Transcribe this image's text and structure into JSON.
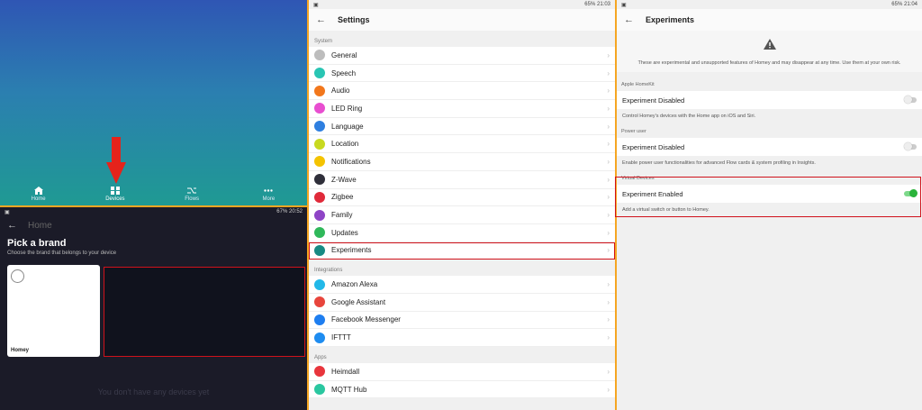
{
  "home": {
    "tabs": [
      {
        "label": "Home",
        "icon": "home-icon"
      },
      {
        "label": "Devices",
        "icon": "devices-grid-icon"
      },
      {
        "label": "Flows",
        "icon": "flows-icon"
      },
      {
        "label": "More",
        "icon": "more-dots-icon"
      }
    ]
  },
  "pick_brand": {
    "status_battery": "67%",
    "status_time": "20:52",
    "app_title": "Home",
    "title": "Pick a brand",
    "subtitle": "Choose the brand that belongs to your device",
    "brand_name": "Homey",
    "empty_message": "You don't have any devices yet"
  },
  "settings": {
    "status_battery": "65%",
    "status_time": "21:03",
    "title": "Settings",
    "sections": [
      {
        "label": "System",
        "items": [
          {
            "label": "General",
            "color": "#bdbdbd"
          },
          {
            "label": "Speech",
            "color": "#29c5b3"
          },
          {
            "label": "Audio",
            "color": "#f2771c"
          },
          {
            "label": "LED Ring",
            "color": "#e84ed0"
          },
          {
            "label": "Language",
            "color": "#2e7fe0"
          },
          {
            "label": "Location",
            "color": "#c8d920"
          },
          {
            "label": "Notifications",
            "color": "#f4c300"
          },
          {
            "label": "Z-Wave",
            "color": "#2f2f3a"
          },
          {
            "label": "Zigbee",
            "color": "#e02a3a"
          },
          {
            "label": "Family",
            "color": "#8e44c6"
          },
          {
            "label": "Updates",
            "color": "#2fb85a"
          },
          {
            "label": "Experiments",
            "color": "#178a83"
          }
        ]
      },
      {
        "label": "Integrations",
        "items": [
          {
            "label": "Amazon Alexa",
            "color": "#22b8e8"
          },
          {
            "label": "Google Assistant",
            "color": "#e8453c"
          },
          {
            "label": "Facebook Messenger",
            "color": "#1e7ef0"
          },
          {
            "label": "IFTTT",
            "color": "#1e8cf0"
          }
        ]
      },
      {
        "label": "Apps",
        "items": [
          {
            "label": "Heimdall",
            "color": "#e8353c"
          },
          {
            "label": "MQTT Hub",
            "color": "#2ac7a0"
          }
        ]
      }
    ]
  },
  "experiments": {
    "status_battery": "65%",
    "status_time": "21:04",
    "title": "Experiments",
    "warning": "These are experimental and unsupported features of Homey and may disappear at any time. Use them at your own risk.",
    "groups": [
      {
        "section": "Apple HomeKit",
        "label": "Experiment Disabled",
        "enabled": false,
        "desc": "Control Homey's devices with the Home app on iOS and Siri."
      },
      {
        "section": "Power user",
        "label": "Experiment Disabled",
        "enabled": false,
        "desc": "Enable power user functionalities for advanced Flow cards & system profiling in Insights."
      },
      {
        "section": "Virtual Devices",
        "label": "Experiment Enabled",
        "enabled": true,
        "desc": "Add a virtual switch or button to Homey."
      }
    ]
  },
  "colors": {
    "highlight": "#d0121b",
    "toggle_on": "#2ab33a"
  }
}
